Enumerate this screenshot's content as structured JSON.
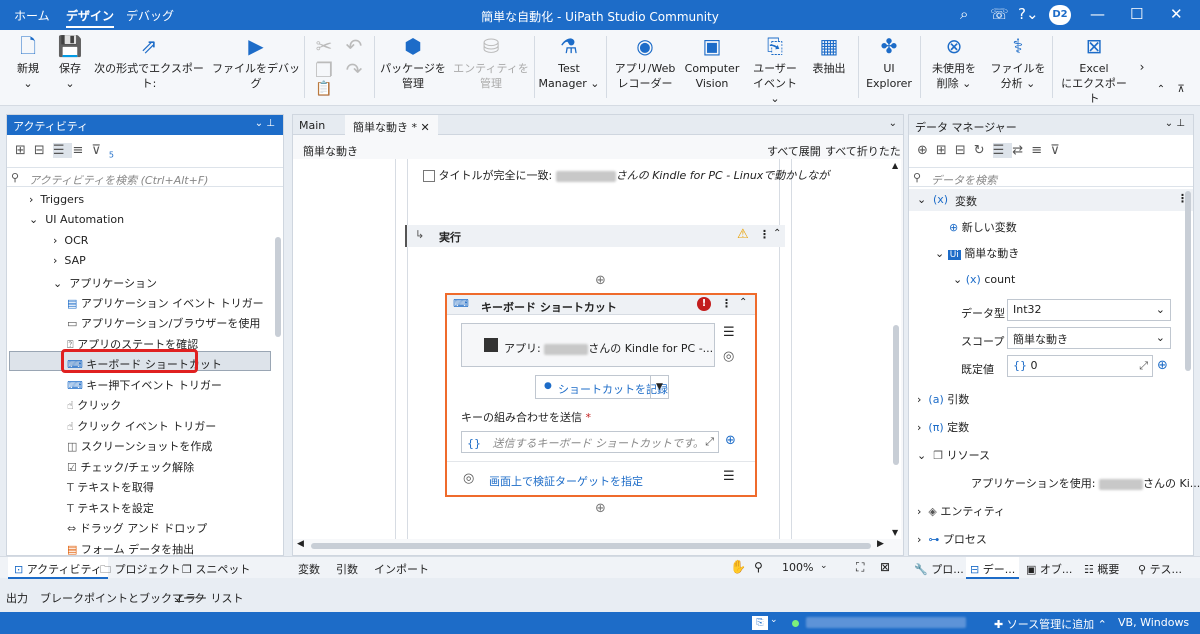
{
  "titlebar": {
    "tabs": [
      "ホーム",
      "デザイン",
      "デバッグ"
    ],
    "title": "簡単な自動化 - UiPath Studio Community",
    "avatar": "D2"
  },
  "ribbon": {
    "new": "新規",
    "save": "保存",
    "export_as": "次の形式でエクスポート:",
    "debug_file": "ファイルをデバッグ",
    "package_manage": [
      "パッケージを",
      "管理"
    ],
    "entity_manage": [
      "エンティティを",
      "管理"
    ],
    "test_manager": [
      "Test",
      "Manager ⌄"
    ],
    "recorder": [
      "アプリ/Web",
      "レコーダー"
    ],
    "computer_vision": [
      "Computer",
      "Vision"
    ],
    "user_event": [
      "ユーザー",
      "イベント ⌄"
    ],
    "table_extract": "表抽出",
    "ui_explorer": [
      "UI",
      "Explorer"
    ],
    "remove_unused": [
      "未使用を",
      "削除 ⌄"
    ],
    "analyze_file": [
      "ファイルを",
      "分析 ⌄"
    ],
    "excel_export": [
      "Excel",
      "にエクスポート"
    ]
  },
  "activities": {
    "title": "アクティビティ",
    "search_placeholder": "アクティビティを検索 (Ctrl+Alt+F)",
    "filter_count": "5",
    "items": [
      "Triggers",
      "UI Automation",
      "OCR",
      "SAP",
      "アプリケーション",
      "アプリケーション イベント トリガー",
      "アプリケーション/ブラウザーを使用",
      "アプリのステートを確認",
      "キーボード ショートカット",
      "キー押下イベント トリガー",
      "クリック",
      "クリック イベント トリガー",
      "スクリーンショットを作成",
      "チェック/チェック解除",
      "テキストを取得",
      "テキストを設定",
      "ドラッグ アンド ドロップ",
      "フォーム データを抽出"
    ]
  },
  "left_bottom_tabs": [
    "アクティビティ",
    "プロジェクト",
    "スニペット"
  ],
  "designer": {
    "tabs": [
      "Main",
      "簡単な動き *"
    ],
    "breadcrumb": "簡単な動き",
    "expand_all": "すべて展開",
    "collapse_all": "すべて折りたたむ",
    "top_checkbox_label": "タイトルが完全に一致:",
    "top_checkbox_suffix": "さんの Kindle for PC - Linuxで動かしなが",
    "do_label": "実行",
    "activity_title": "キーボード ショートカット",
    "app_label": "アプリ:",
    "app_suffix": "さんの Kindle for PC -...",
    "record_button": "ショートカットを記録",
    "send_keys_label": "キーの組み合わせを送信",
    "send_keys_required": "*",
    "send_keys_placeholder": "送信するキーボード ショートカットです。",
    "verify_target": "画面上で検証ターゲットを指定",
    "bottom_tabs": [
      "変数",
      "引数",
      "インポート"
    ],
    "zoom": "100%"
  },
  "data_manager": {
    "title": "データ マネージャー",
    "search_placeholder": "データを検索",
    "variables": "変数",
    "new_variable": "新しい変数",
    "scope_name": "簡単な動き",
    "var_name": "count",
    "type_label": "データ型",
    "type_value": "Int32",
    "scope_label": "スコープ",
    "scope_value": "簡単な動き",
    "default_label": "既定値",
    "default_value": "0",
    "arguments": "引数",
    "constants": "定数",
    "resources": "リソース",
    "resource_item": "アプリケーションを使用:",
    "resource_suffix": "さんの Ki...",
    "entities": "エンティティ",
    "processes": "プロセス"
  },
  "right_bottom_tabs": [
    "プロ...",
    "デー...",
    "オブ...",
    "概要",
    "テス..."
  ],
  "output_tabs": [
    "出力",
    "ブレークポイントとブックマーク",
    "エラー リスト"
  ],
  "statusbar": {
    "add_source": "ソース管理に追加",
    "language": "VB, Windows"
  }
}
